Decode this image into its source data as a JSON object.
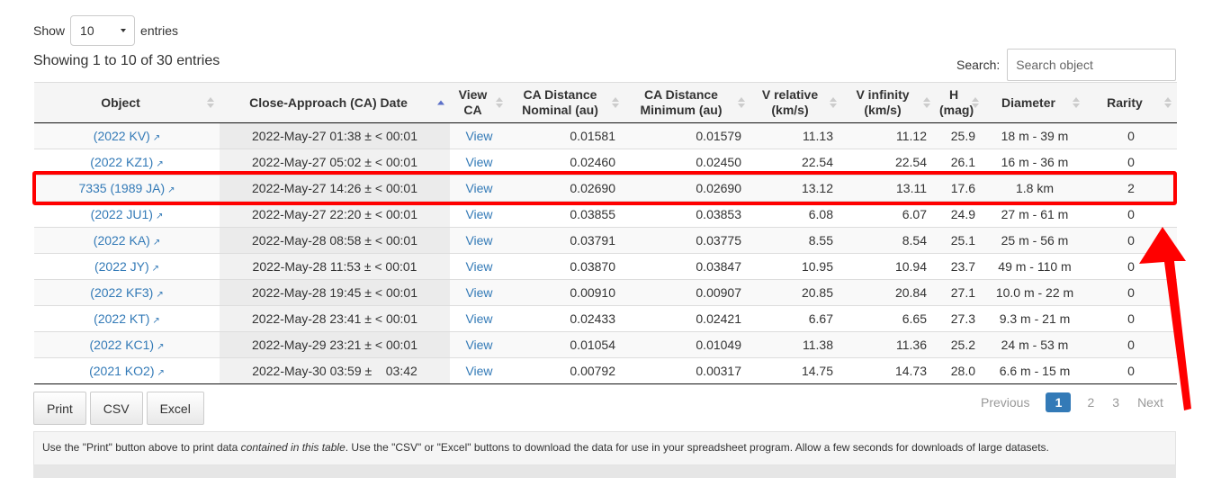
{
  "length_menu": {
    "show": "Show",
    "value": "10",
    "entries": "entries"
  },
  "info": "Showing 1 to 10 of 30 entries",
  "search": {
    "label": "Search:",
    "placeholder": "Search object"
  },
  "columns": [
    {
      "l1": "Object",
      "l2": ""
    },
    {
      "l1": "Close-Approach (CA) Date",
      "l2": ""
    },
    {
      "l1": "View",
      "l2": "CA"
    },
    {
      "l1": "CA Distance",
      "l2": "Nominal (au)"
    },
    {
      "l1": "CA Distance",
      "l2": "Minimum (au)"
    },
    {
      "l1": "V relative",
      "l2": "(km/s)"
    },
    {
      "l1": "V infinity",
      "l2": "(km/s)"
    },
    {
      "l1": "H",
      "l2": "(mag)"
    },
    {
      "l1": "Diameter",
      "l2": ""
    },
    {
      "l1": "Rarity",
      "l2": ""
    }
  ],
  "rows": [
    {
      "object": "(2022 KV)",
      "date": "2022-May-27 01:38 ± < 00:01",
      "view": "View",
      "nom": "0.01581",
      "min": "0.01579",
      "vrel": "11.13",
      "vinf": "11.12",
      "h": "25.9",
      "diam": "18 m - 39 m",
      "rarity": "0"
    },
    {
      "object": "(2022 KZ1)",
      "date": "2022-May-27 05:02 ± < 00:01",
      "view": "View",
      "nom": "0.02460",
      "min": "0.02450",
      "vrel": "22.54",
      "vinf": "22.54",
      "h": "26.1",
      "diam": "16 m - 36 m",
      "rarity": "0"
    },
    {
      "object": "7335 (1989 JA)",
      "date": "2022-May-27 14:26 ± < 00:01",
      "view": "View",
      "nom": "0.02690",
      "min": "0.02690",
      "vrel": "13.12",
      "vinf": "13.11",
      "h": "17.6",
      "diam": "1.8 km",
      "rarity": "2"
    },
    {
      "object": "(2022 JU1)",
      "date": "2022-May-27 22:20 ± < 00:01",
      "view": "View",
      "nom": "0.03855",
      "min": "0.03853",
      "vrel": "6.08",
      "vinf": "6.07",
      "h": "24.9",
      "diam": "27 m - 61 m",
      "rarity": "0"
    },
    {
      "object": "(2022 KA)",
      "date": "2022-May-28 08:58 ± < 00:01",
      "view": "View",
      "nom": "0.03791",
      "min": "0.03775",
      "vrel": "8.55",
      "vinf": "8.54",
      "h": "25.1",
      "diam": "25 m - 56 m",
      "rarity": "0"
    },
    {
      "object": "(2022 JY)",
      "date": "2022-May-28 11:53 ± < 00:01",
      "view": "View",
      "nom": "0.03870",
      "min": "0.03847",
      "vrel": "10.95",
      "vinf": "10.94",
      "h": "23.7",
      "diam": "49 m - 110 m",
      "rarity": "0"
    },
    {
      "object": "(2022 KF3)",
      "date": "2022-May-28 19:45 ± < 00:01",
      "view": "View",
      "nom": "0.00910",
      "min": "0.00907",
      "vrel": "20.85",
      "vinf": "20.84",
      "h": "27.1",
      "diam": "10.0 m - 22 m",
      "rarity": "0"
    },
    {
      "object": "(2022 KT)",
      "date": "2022-May-28 23:41 ± < 00:01",
      "view": "View",
      "nom": "0.02433",
      "min": "0.02421",
      "vrel": "6.67",
      "vinf": "6.65",
      "h": "27.3",
      "diam": "9.3 m - 21 m",
      "rarity": "0"
    },
    {
      "object": "(2022 KC1)",
      "date": "2022-May-29 23:21 ± < 00:01",
      "view": "View",
      "nom": "0.01054",
      "min": "0.01049",
      "vrel": "11.38",
      "vinf": "11.36",
      "h": "25.2",
      "diam": "24 m - 53 m",
      "rarity": "0"
    },
    {
      "object": "(2021 KO2)",
      "date": "2022-May-30 03:59 ±    03:42",
      "view": "View",
      "nom": "0.00792",
      "min": "0.00317",
      "vrel": "14.75",
      "vinf": "14.73",
      "h": "28.0",
      "diam": "6.6 m - 15 m",
      "rarity": "0"
    }
  ],
  "buttons": {
    "print": "Print",
    "csv": "CSV",
    "excel": "Excel"
  },
  "pagination": {
    "previous": "Previous",
    "pages": [
      "1",
      "2",
      "3"
    ],
    "next": "Next"
  },
  "notice": {
    "part1": "Use the \"Print\" button above to print data ",
    "italic": "contained in this table",
    "part2": ". Use the \"CSV\" or \"Excel\" buttons to download the data for use in your spreadsheet program. Allow a few seconds for downloads of large datasets."
  },
  "icons": {
    "external_link": "external-link-icon",
    "sort": "sort-icon",
    "dropdown": "chevron-down-icon"
  },
  "colors": {
    "link": "#337ab7",
    "highlight": "#ff0000",
    "active_page": "#337ab7"
  }
}
